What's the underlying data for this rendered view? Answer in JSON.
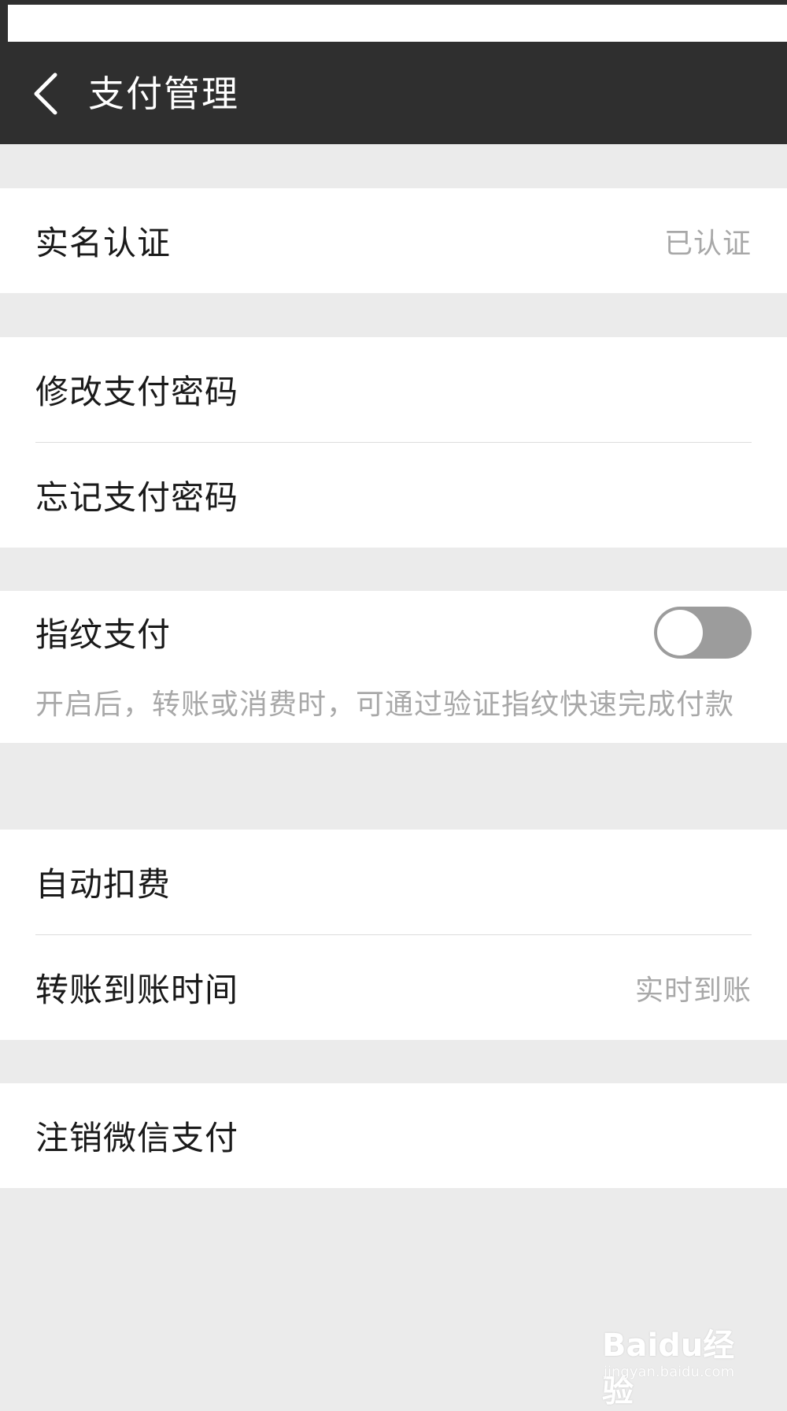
{
  "header": {
    "title": "支付管理",
    "back_icon": "chevron-left-icon"
  },
  "sections": {
    "verification": {
      "label": "实名认证",
      "value": "已认证"
    },
    "password": {
      "change_label": "修改支付密码",
      "forgot_label": "忘记支付密码"
    },
    "fingerprint": {
      "label": "指纹支付",
      "enabled": false,
      "description": "开启后，转账或消费时，可通过验证指纹快速完成付款"
    },
    "deduction": {
      "auto_label": "自动扣费",
      "transfer_label": "转账到账时间",
      "transfer_value": "实时到账"
    },
    "cancel": {
      "label": "注销微信支付"
    }
  },
  "watermark": {
    "brand": "Baidu经验",
    "sub": "jingyan.baidu.com"
  },
  "colors": {
    "nav_bg": "#2f2f2f",
    "page_bg": "#ebebeb",
    "toggle_off": "#9c9c9c",
    "secondary_text": "#a8a8a8"
  }
}
